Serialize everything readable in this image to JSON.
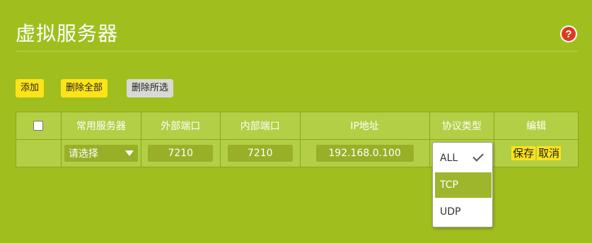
{
  "page": {
    "title": "虚拟服务器",
    "help_glyph": "?"
  },
  "toolbar": {
    "add_label": "添加",
    "delete_all_label": "删除全部",
    "delete_selected_label": "删除所选"
  },
  "table": {
    "headers": [
      "常用服务器",
      "外部端口",
      "内部端口",
      "IP地址",
      "协议类型",
      "编辑"
    ],
    "row": {
      "service_select": "请选择",
      "external_port": "7210",
      "internal_port": "7210",
      "ip_address": "192.168.0.100",
      "save_label": "保存",
      "cancel_label": "取消"
    }
  },
  "protocol_dropdown": {
    "options": [
      "ALL",
      "TCP",
      "UDP"
    ],
    "checked": "ALL",
    "highlighted": "TCP"
  },
  "colors": {
    "background": "#a0bf1f",
    "accent_button": "#ffe319",
    "help": "#e0391f"
  }
}
